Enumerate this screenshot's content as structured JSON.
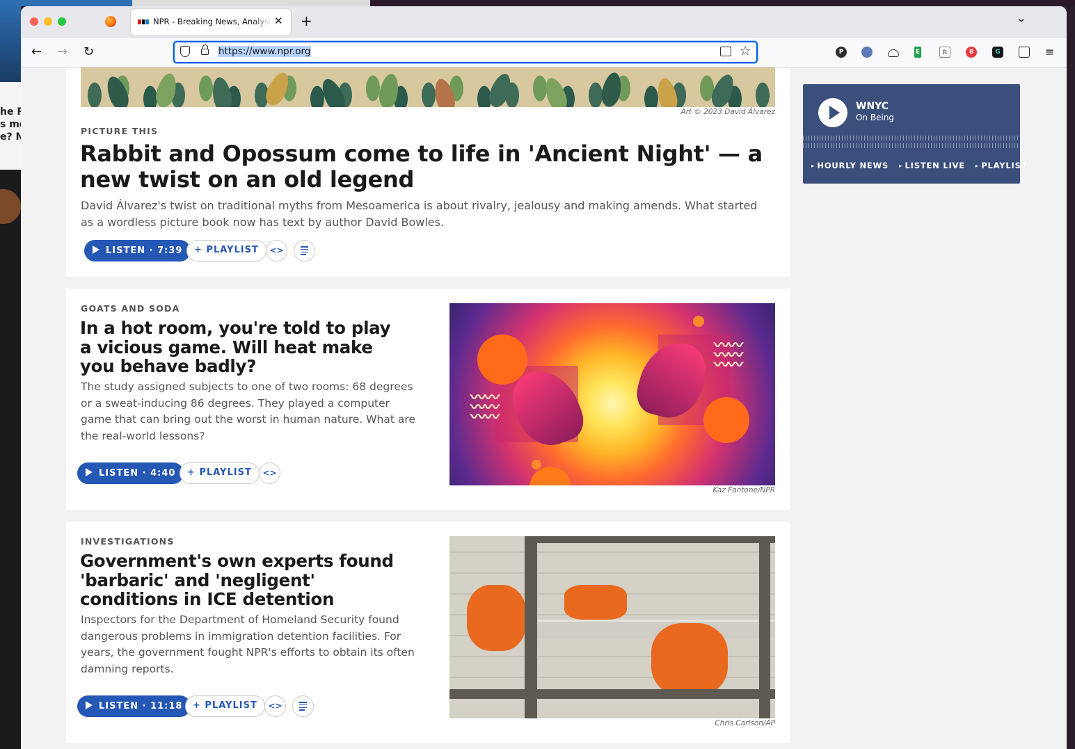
{
  "browser": {
    "tab_title": "NPR - Breaking News, Analysis, Music, Arts & Podcasts",
    "tab_close": "✕",
    "new_tab": "+",
    "tab_list": "⌄",
    "url": "https://www.npr.org",
    "back": "←",
    "forward": "→",
    "reload": "↻",
    "star": "☆",
    "menu": "≡",
    "extensions": [
      {
        "name": "p-extension",
        "label": "P",
        "color": "#2c2c32"
      },
      {
        "name": "reader-extension",
        "label": "",
        "color": "#5b7bb8"
      },
      {
        "name": "cloud-extension",
        "label": "",
        "color": "#ffffff"
      },
      {
        "name": "evernote-extension",
        "label": "E",
        "color": "#1aa04a"
      },
      {
        "name": "rb-extension",
        "label": "R",
        "color": "#8a8a8a"
      },
      {
        "name": "adblock-extension",
        "label": "8",
        "color": "#e83a3a"
      },
      {
        "name": "g-extension",
        "label": "G",
        "color": "#15141a"
      },
      {
        "name": "puzzle-extension",
        "label": "",
        "color": "#ffffff"
      }
    ]
  },
  "stories": [
    {
      "credit": "Art © 2023 David Álvarez",
      "slug": "Picture This",
      "headline": "Rabbit and Opossum come to life in 'Ancient Night' — a new twist on an old legend",
      "teaser": "David Álvarez's twist on traditional myths from Mesoamerica is about rivalry, jealousy and making amends. What started as a wordless picture book now has text by author David Bowles.",
      "listen": "LISTEN · 7:39",
      "playlist": "+ PLAYLIST",
      "embed": "<>"
    },
    {
      "credit": "Kaz Fantone/NPR",
      "slug": "Goats and Soda",
      "headline": "In a hot room, you're told to play a vicious game. Will heat make you behave badly?",
      "teaser": "The study assigned subjects to one of two rooms: 68 degrees or a sweat-inducing 86 degrees. They played a computer game that can bring out the worst in human nature. What are the real-world lessons?",
      "listen": "LISTEN · 4:40",
      "playlist": "+ PLAYLIST",
      "embed": "<>"
    },
    {
      "credit": "Chris Carlson/AP",
      "slug": "Investigations",
      "headline": "Government's own experts found 'barbaric' and 'negligent' conditions in ICE detention",
      "teaser": "Inspectors for the Department of Homeland Security found dangerous problems in immigration detention facilities. For years, the government fought NPR's efforts to obtain its often damning reports.",
      "listen": "LISTEN · 11:18",
      "playlist": "+ PLAYLIST",
      "embed": "<>"
    }
  ],
  "player": {
    "station": "WNYC",
    "show": "On Being",
    "links": [
      "HOURLY NEWS",
      "LISTEN LIVE",
      "PLAYLIST"
    ]
  },
  "desktop": {
    "peek_text": [
      "he R",
      "s me",
      "e? N"
    ]
  },
  "colors": {
    "npr_blue": "#2557b5",
    "player_bg": "#3a4f7c",
    "url_focus": "#0061e0"
  }
}
